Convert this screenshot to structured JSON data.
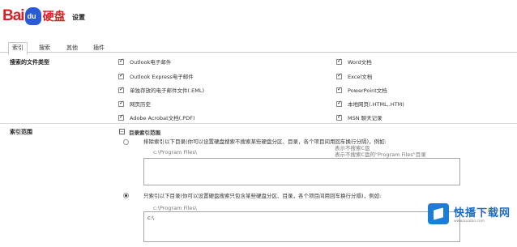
{
  "header": {
    "logo_prefix": "Bai",
    "logo_paw": "du",
    "logo_suffix": "硬盘",
    "title": "设置"
  },
  "tabs": [
    {
      "label": "索引",
      "active": true
    },
    {
      "label": "搜索",
      "active": false
    },
    {
      "label": "其他",
      "active": false
    },
    {
      "label": "插件",
      "active": false
    }
  ],
  "file_types": {
    "label": "搜索的文件类型",
    "left": [
      {
        "label": "Outlook电子邮件",
        "checked": true
      },
      {
        "label": "Outlook Express电子邮件",
        "checked": true
      },
      {
        "label": "单独存放的电子邮件文件(.EML)",
        "checked": true
      },
      {
        "label": "网页历史",
        "checked": true
      },
      {
        "label": "Adobe Acrobat文档(.PDF)",
        "checked": true
      }
    ],
    "right": [
      {
        "label": "Word文档",
        "checked": true
      },
      {
        "label": "Excel文档",
        "checked": true
      },
      {
        "label": "PowerPoint文档",
        "checked": true
      },
      {
        "label": "本地网页(.HTML,.HTM)",
        "checked": true
      },
      {
        "label": "MSN 聊天记录",
        "checked": true
      }
    ]
  },
  "index_range": {
    "label": "索引范围",
    "tree_label": "目录索引范围",
    "option1": {
      "text": "排除索引以下目录(你可以设置硬盘搜索不搜索某些硬盘分区、目录，各个项目间用回车换行分隔)，例如:",
      "hint1": "表示不搜索C盘",
      "hint2": "表示不搜索C盘的\"Program Files\"目录",
      "example": "c:\\Program Files\\"
    },
    "option2": {
      "text": "只索引以下目录(你可以设置硬盘搜索只包含某些硬盘分区、目录，各个项目间用回车换行分隔)，例如:",
      "example": "c:\\Program Files\\",
      "value": "c:\\"
    }
  },
  "watermark": {
    "title": "快播下载网",
    "sub": "www.kuaibo.com"
  }
}
